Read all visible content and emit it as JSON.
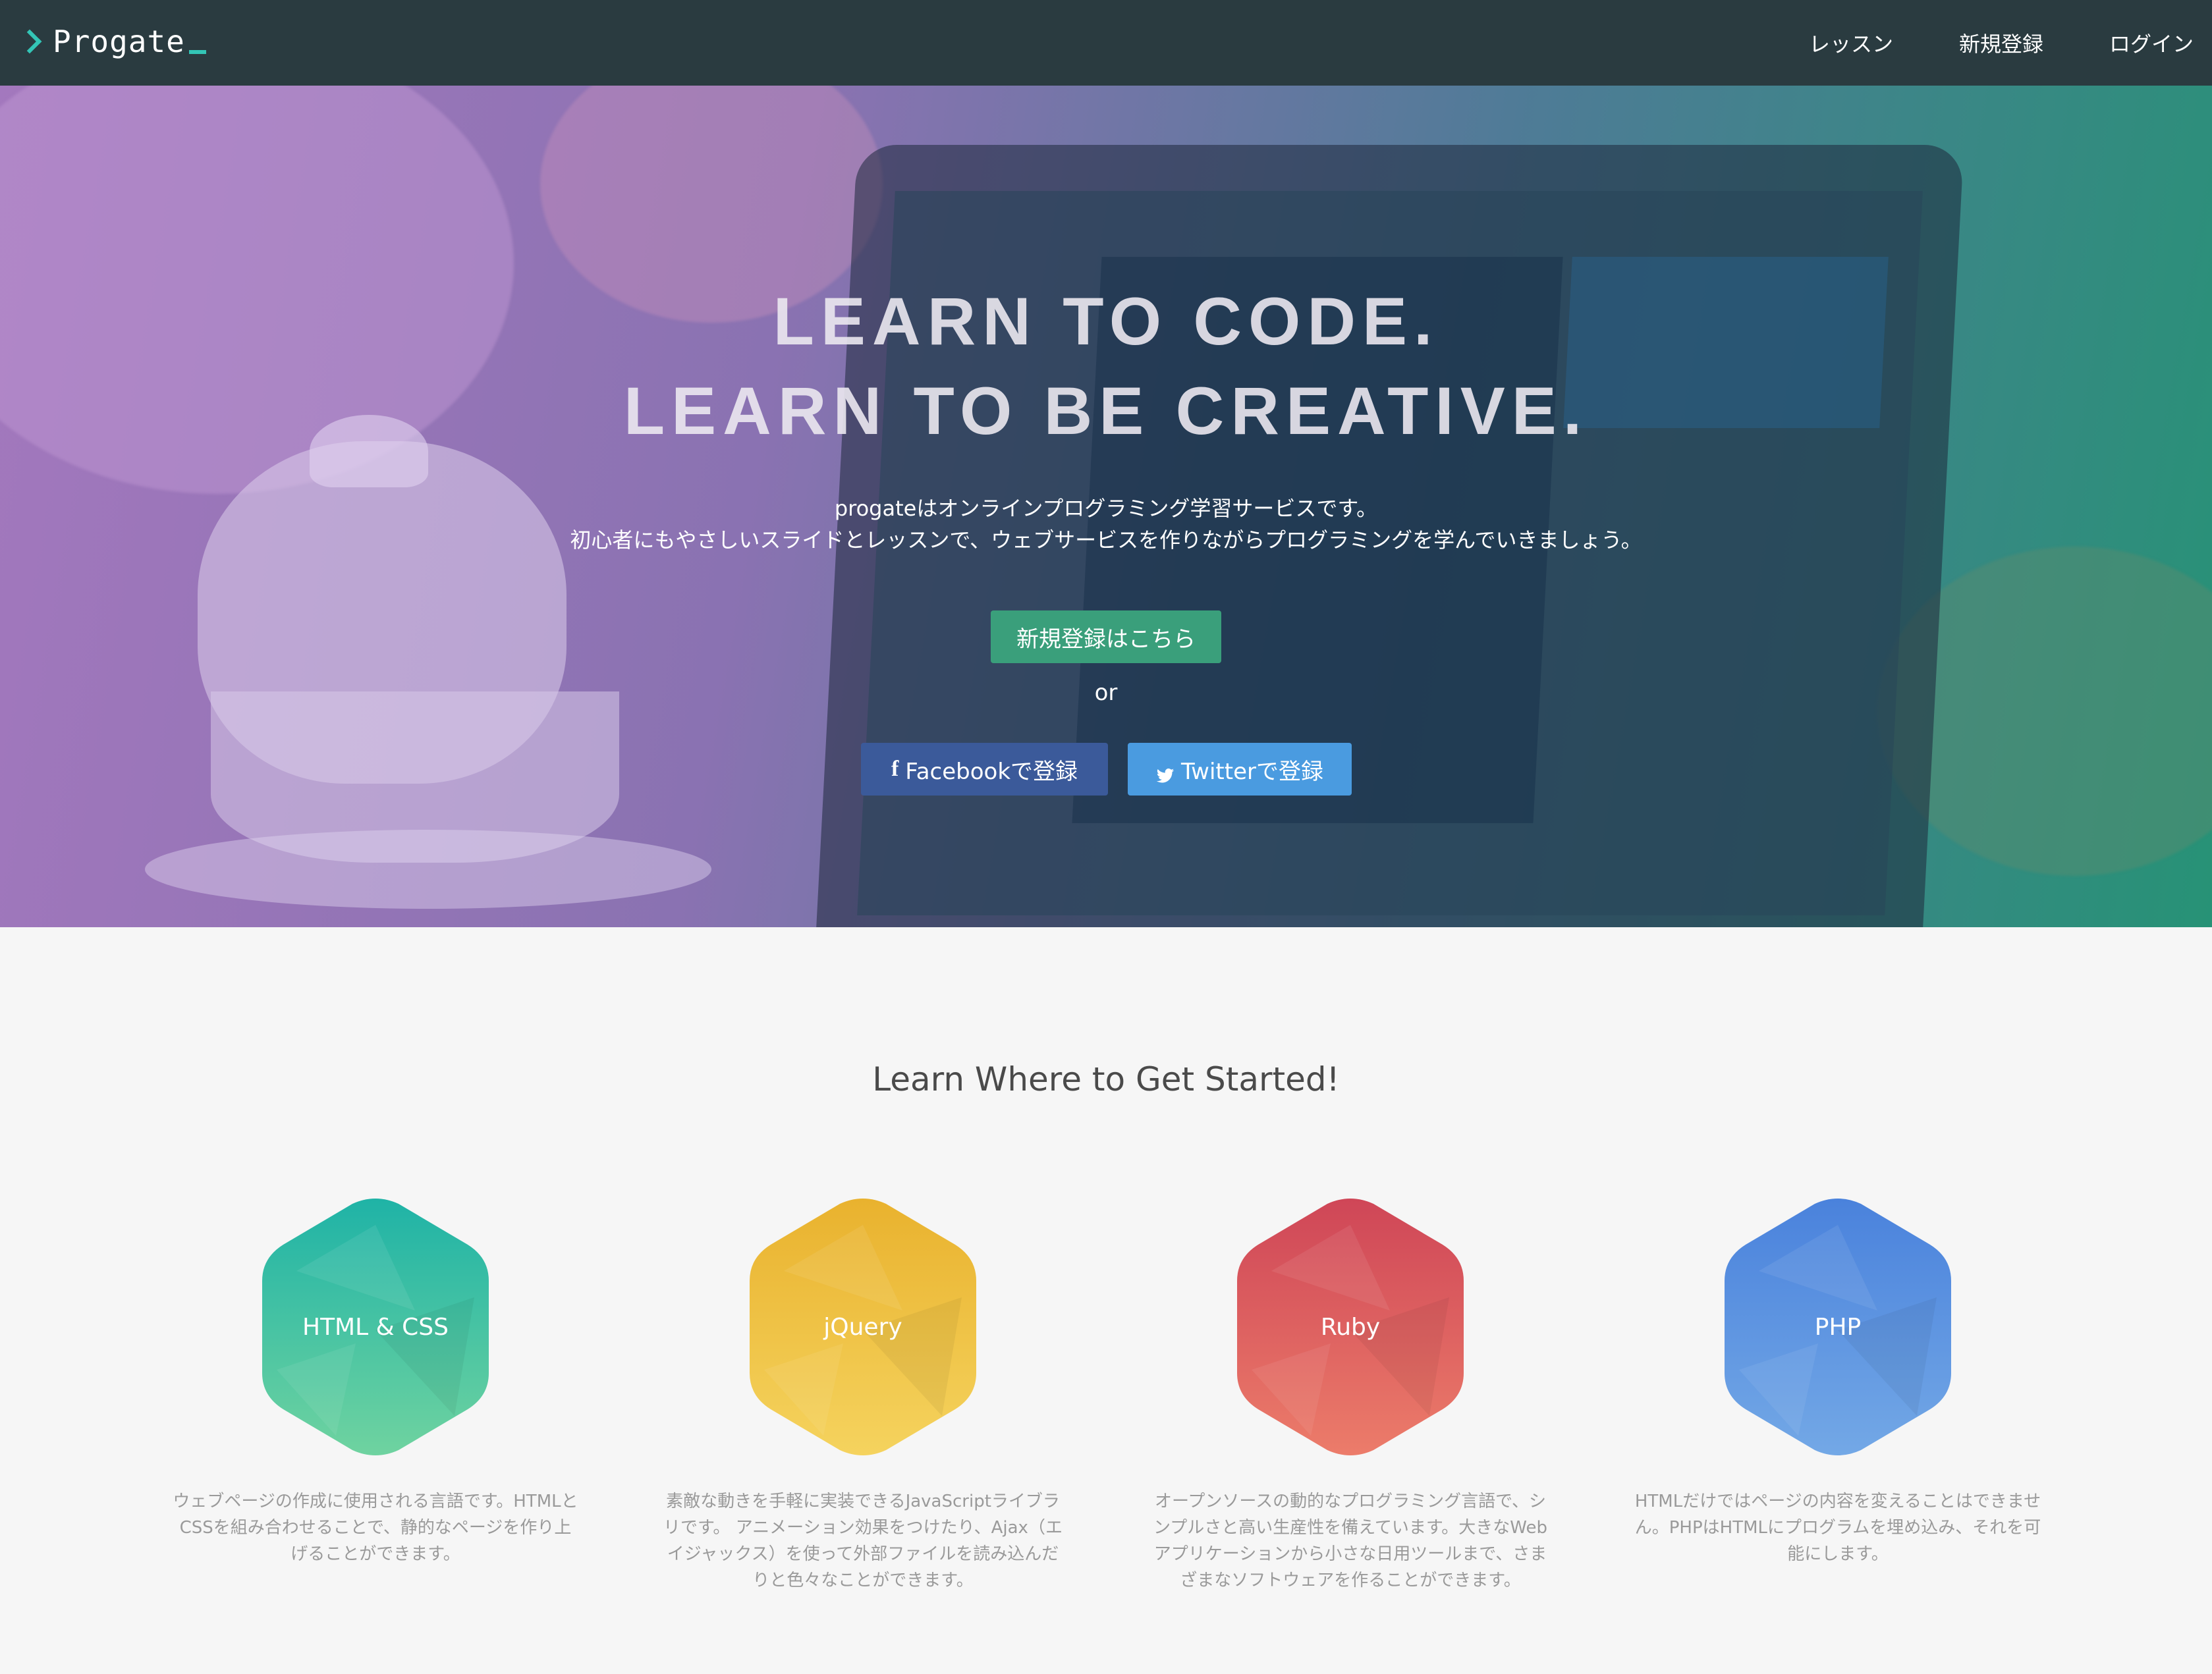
{
  "nav": {
    "logo": "Progate",
    "links": [
      "レッスン",
      "新規登録",
      "ログイン"
    ]
  },
  "hero": {
    "title_line1": "LEARN TO CODE.",
    "title_line2": "LEARN TO BE CREATIVE.",
    "subtitle_line1": "progateはオンラインプログラミング学習サービスです。",
    "subtitle_line2": "初心者にもやさしいスライドとレッスンで、ウェブサービスを作りながらプログラミングを学んでいきましょう。",
    "signup_button": "新規登録はこちら",
    "or_text": "or",
    "facebook_button": "Facebookで登録",
    "facebook_icon_glyph": "f",
    "twitter_button": "Twitterで登録"
  },
  "section": {
    "title": "Learn Where to Get Started!"
  },
  "courses": [
    {
      "name": "HTML & CSS",
      "icon": "html-css-hexagon-icon",
      "color_top": "#1fb3a6",
      "color_bottom": "#6fd3a0",
      "desc": "ウェブページの作成に使用される言語です。HTMLとCSSを組み合わせることで、静的なページを作り上げることができます。"
    },
    {
      "name": "jQuery",
      "icon": "jquery-hexagon-icon",
      "color_top": "#e9b22e",
      "color_bottom": "#f5d35e",
      "desc": "素敵な動きを手軽に実装できるJavaScriptライブラリです。 アニメーション効果をつけたり、Ajax（エイジャックス）を使って外部ファイルを読み込んだりと色々なことができます。"
    },
    {
      "name": "Ruby",
      "icon": "ruby-hexagon-icon",
      "color_top": "#cf4657",
      "color_bottom": "#ec7c6a",
      "desc": "オープンソースの動的なプログラミング言語で、シンプルさと高い生産性を備えています。大きなWebアプリケーションから小さな日用ツールまで、さまざまなソフトウェアを作ることができます。"
    },
    {
      "name": "PHP",
      "icon": "php-hexagon-icon",
      "color_top": "#4a82dc",
      "color_bottom": "#73a8e6",
      "desc": "HTMLだけではページの内容を変えることはできません。PHPはHTMLにプログラムを埋め込み、それを可能にします。"
    }
  ]
}
